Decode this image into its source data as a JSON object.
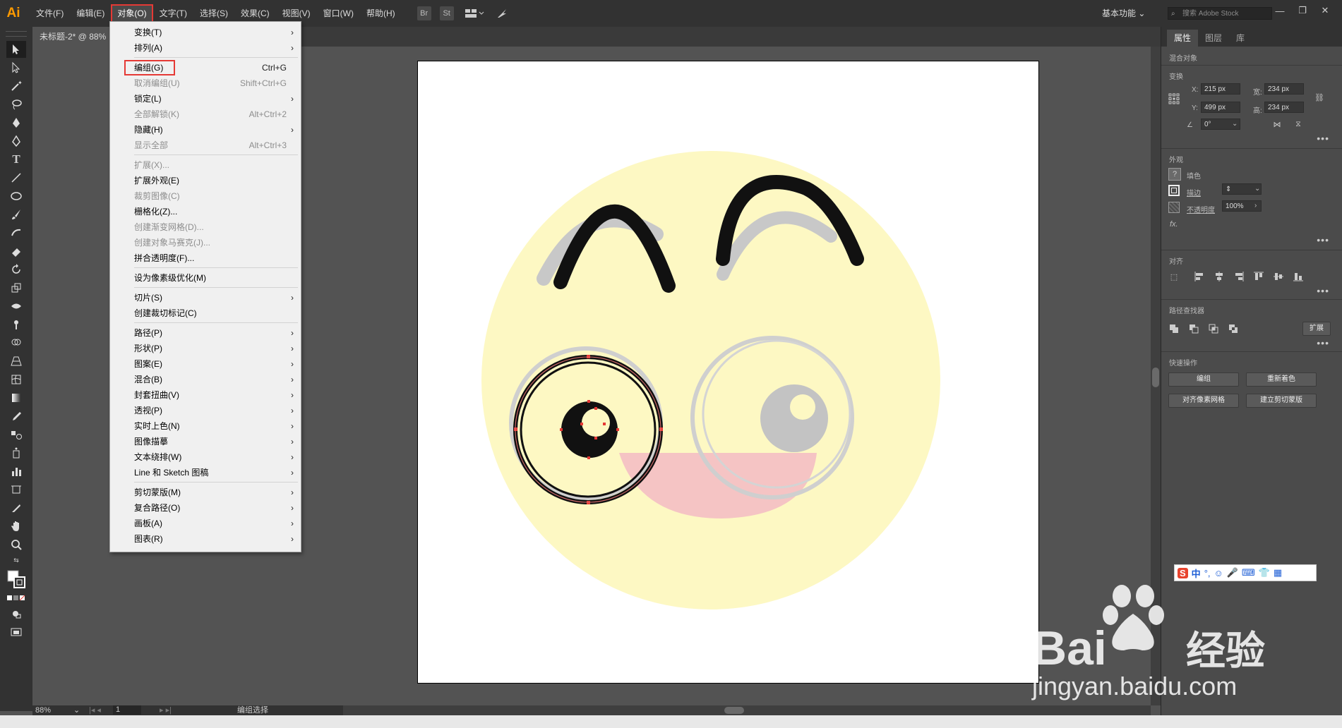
{
  "app": {
    "logo": "Ai"
  },
  "menubar": {
    "items": [
      "文件(F)",
      "编辑(E)",
      "对象(O)",
      "文字(T)",
      "选择(S)",
      "效果(C)",
      "视图(V)",
      "窗口(W)",
      "帮助(H)"
    ],
    "icons": [
      "Br",
      "St"
    ],
    "workspace": "基本功能",
    "search_placeholder": "搜索 Adobe Stock"
  },
  "document": {
    "tab_title": "未标题-2* @ 88%"
  },
  "object_menu": [
    {
      "label": "变换(T)",
      "shortcut": "",
      "submenu": true,
      "disabled": false
    },
    {
      "label": "排列(A)",
      "shortcut": "",
      "submenu": true,
      "disabled": false
    },
    {
      "label": "编组(G)",
      "shortcut": "Ctrl+G",
      "submenu": false,
      "disabled": false,
      "highlight": true
    },
    {
      "label": "取消编组(U)",
      "shortcut": "Shift+Ctrl+G",
      "submenu": false,
      "disabled": true
    },
    {
      "label": "锁定(L)",
      "shortcut": "",
      "submenu": true,
      "disabled": false
    },
    {
      "label": "全部解锁(K)",
      "shortcut": "Alt+Ctrl+2",
      "submenu": false,
      "disabled": true
    },
    {
      "label": "隐藏(H)",
      "shortcut": "",
      "submenu": true,
      "disabled": false
    },
    {
      "label": "显示全部",
      "shortcut": "Alt+Ctrl+3",
      "submenu": false,
      "disabled": true
    },
    {
      "label": "扩展(X)...",
      "shortcut": "",
      "submenu": false,
      "disabled": true
    },
    {
      "label": "扩展外观(E)",
      "shortcut": "",
      "submenu": false,
      "disabled": false
    },
    {
      "label": "裁剪图像(C)",
      "shortcut": "",
      "submenu": false,
      "disabled": true
    },
    {
      "label": "栅格化(Z)...",
      "shortcut": "",
      "submenu": false,
      "disabled": false
    },
    {
      "label": "创建渐变网格(D)...",
      "shortcut": "",
      "submenu": false,
      "disabled": true
    },
    {
      "label": "创建对象马赛克(J)...",
      "shortcut": "",
      "submenu": false,
      "disabled": true
    },
    {
      "label": "拼合透明度(F)...",
      "shortcut": "",
      "submenu": false,
      "disabled": false
    },
    {
      "label": "设为像素级优化(M)",
      "shortcut": "",
      "submenu": false,
      "disabled": false
    },
    {
      "label": "切片(S)",
      "shortcut": "",
      "submenu": true,
      "disabled": false
    },
    {
      "label": "创建裁切标记(C)",
      "shortcut": "",
      "submenu": false,
      "disabled": false
    },
    {
      "label": "路径(P)",
      "shortcut": "",
      "submenu": true,
      "disabled": false
    },
    {
      "label": "形状(P)",
      "shortcut": "",
      "submenu": true,
      "disabled": false
    },
    {
      "label": "图案(E)",
      "shortcut": "",
      "submenu": true,
      "disabled": false
    },
    {
      "label": "混合(B)",
      "shortcut": "",
      "submenu": true,
      "disabled": false
    },
    {
      "label": "封套扭曲(V)",
      "shortcut": "",
      "submenu": true,
      "disabled": false
    },
    {
      "label": "透视(P)",
      "shortcut": "",
      "submenu": true,
      "disabled": false
    },
    {
      "label": "实时上色(N)",
      "shortcut": "",
      "submenu": true,
      "disabled": false
    },
    {
      "label": "图像描摹",
      "shortcut": "",
      "submenu": true,
      "disabled": false
    },
    {
      "label": "文本绕排(W)",
      "shortcut": "",
      "submenu": true,
      "disabled": false
    },
    {
      "label": "Line 和 Sketch 图稿",
      "shortcut": "",
      "submenu": true,
      "disabled": false
    },
    {
      "label": "剪切蒙版(M)",
      "shortcut": "",
      "submenu": true,
      "disabled": false
    },
    {
      "label": "复合路径(O)",
      "shortcut": "",
      "submenu": true,
      "disabled": false
    },
    {
      "label": "画板(A)",
      "shortcut": "",
      "submenu": true,
      "disabled": false
    },
    {
      "label": "图表(R)",
      "shortcut": "",
      "submenu": true,
      "disabled": false
    }
  ],
  "panel": {
    "tabs": [
      "属性",
      "图层",
      "库"
    ],
    "selection_type": "混合对象",
    "transform": {
      "title": "变换",
      "x_label": "X:",
      "x": "215 px",
      "y_label": "Y:",
      "y": "499 px",
      "w_label": "宽:",
      "w": "234 px",
      "h_label": "高:",
      "h": "234 px",
      "angle": "0°"
    },
    "appearance": {
      "title": "外观",
      "fill": "填色",
      "stroke": "描边",
      "opacity_label": "不透明度",
      "opacity": "100%",
      "fx": "fx."
    },
    "align": {
      "title": "对齐"
    },
    "pathfinder": {
      "title": "路径查找器",
      "expand": "扩展"
    },
    "quick_actions": {
      "title": "快速操作",
      "group": "编组",
      "recolor": "重新着色",
      "align_pixel": "对齐像素网格",
      "make_clip": "建立剪切蒙版"
    }
  },
  "status": {
    "zoom": "88%",
    "page": "1",
    "tool": "编组选择"
  },
  "watermark": {
    "brand": "Bai",
    "brand2": "经验",
    "domain": "jingyan.baidu.com"
  },
  "colors": {
    "accent_red": "#e53935",
    "face": "#fdf8c3",
    "mouth": "#f5c4c4",
    "ghost": "#c8c8c8"
  }
}
